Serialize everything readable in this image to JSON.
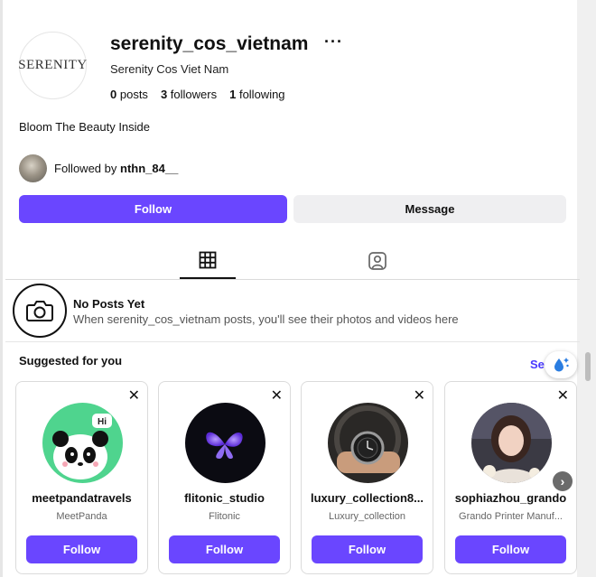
{
  "profile": {
    "avatar_text": "SERENITY",
    "username": "serenity_cos_vietnam",
    "more_icon": "more-icon",
    "full_name": "Serenity Cos Viet Nam",
    "posts_count": "0",
    "posts_label": "posts",
    "followers_count": "3",
    "followers_label": "followers",
    "following_count": "1",
    "following_label": "following",
    "bio": "Bloom The Beauty Inside",
    "followed_by_prefix": "Followed by",
    "followed_by_user": "nthn_84__"
  },
  "actions": {
    "follow_label": "Follow",
    "message_label": "Message"
  },
  "tabs": [
    {
      "icon": "grid-icon",
      "active": true
    },
    {
      "icon": "tagged-icon",
      "active": false
    }
  ],
  "no_posts": {
    "icon": "camera-icon",
    "title": "No Posts Yet",
    "subtitle": "When serenity_cos_vietnam posts, you'll see their photos and videos here"
  },
  "suggested": {
    "title": "Suggested for you",
    "see_all": "See",
    "cards": [
      {
        "name": "meetpandatravels",
        "sub": "MeetPanda",
        "button": "Follow"
      },
      {
        "name": "flitonic_studio",
        "sub": "Flitonic",
        "button": "Follow"
      },
      {
        "name": "luxury_collection8...",
        "sub": "Luxury_collection",
        "button": "Follow"
      },
      {
        "name": "sophiazhou_grando",
        "sub": "Grando Printer Manuf...",
        "button": "Follow"
      }
    ]
  },
  "colors": {
    "accent": "#6a46ff",
    "link": "#4a3aff",
    "secondary_button": "#efeff1"
  }
}
